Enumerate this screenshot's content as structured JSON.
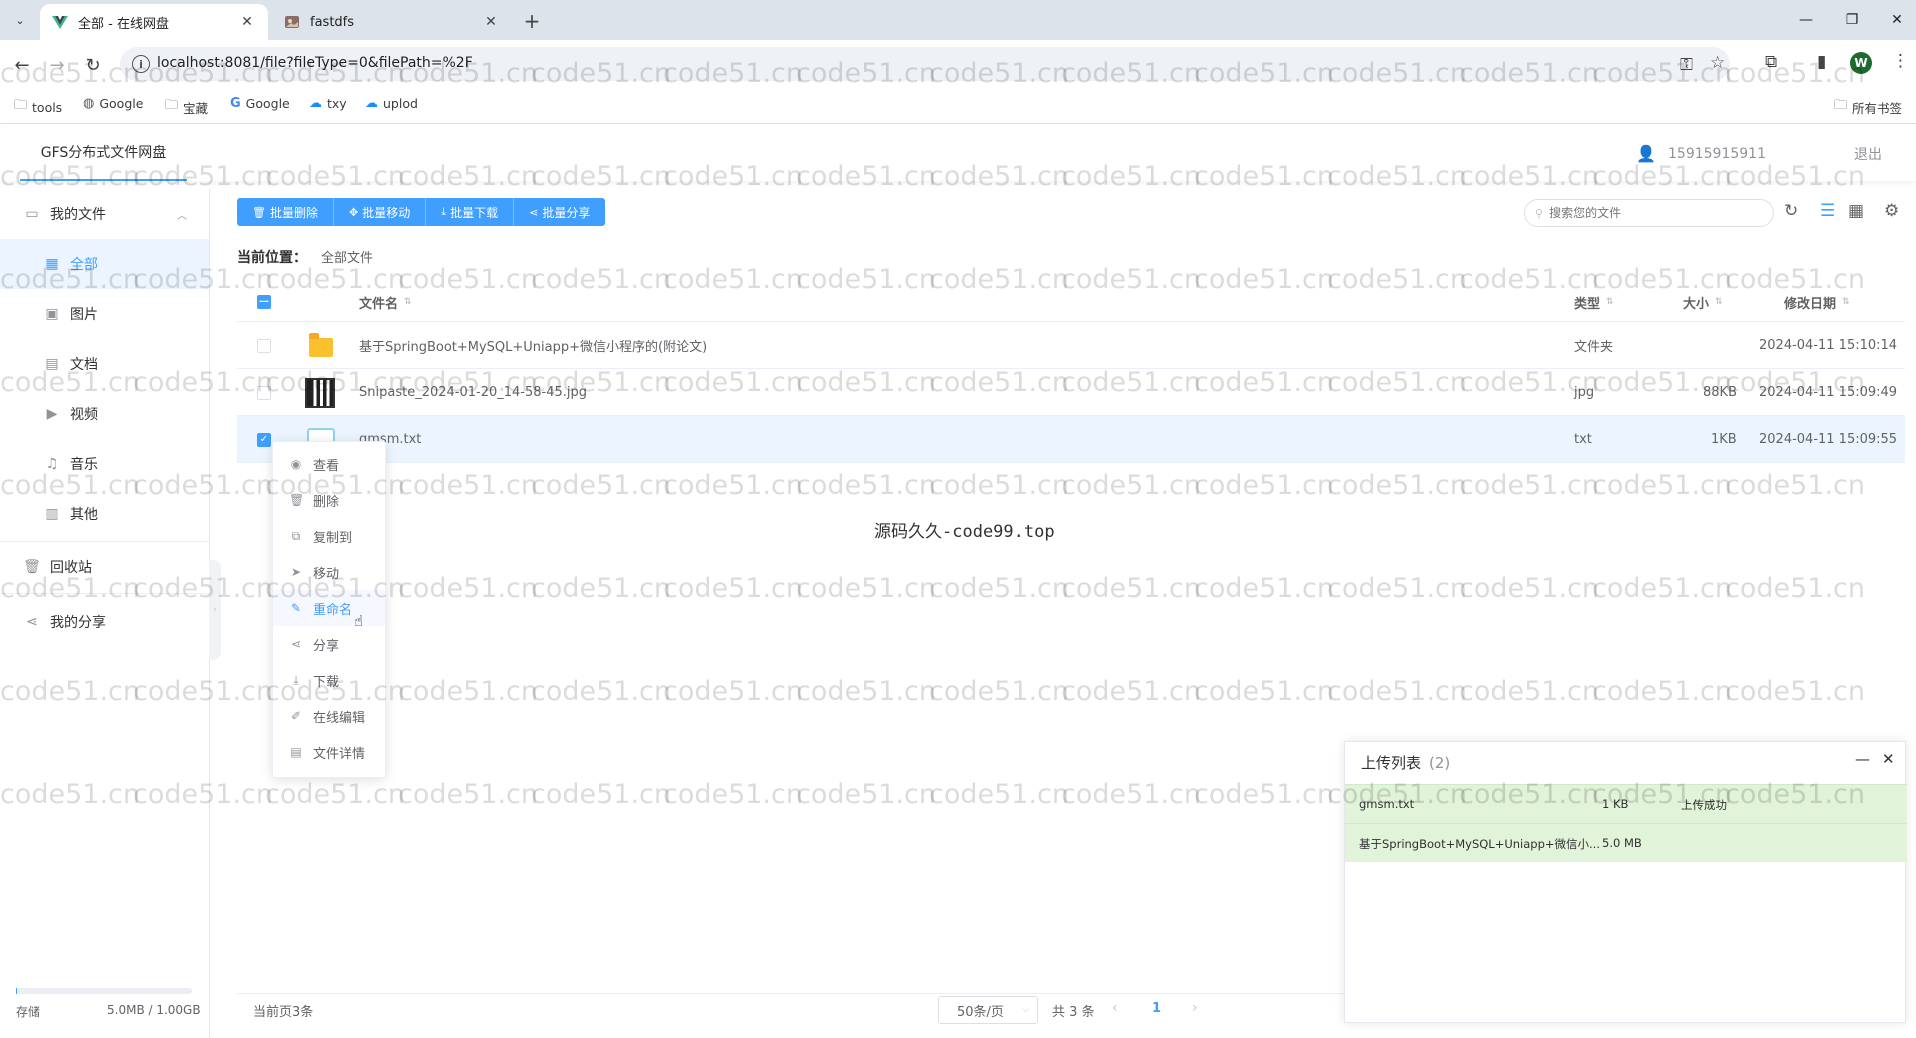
{
  "browser": {
    "tabs": [
      {
        "title": "全部 - 在线网盘",
        "active": true
      },
      {
        "title": "fastdfs",
        "active": false
      }
    ],
    "url": "localhost:8081/file?fileType=0&filePath=%2F",
    "bookmarks": [
      "tools",
      "Google",
      "宝藏",
      "Google",
      "txy",
      "uplod"
    ],
    "all_bookmarks": "所有书签",
    "profile_initial": "W"
  },
  "header": {
    "app_title": "GFS分布式文件网盘",
    "username": "15915915911",
    "logout": "退出"
  },
  "sidebar": {
    "my_files": "我的文件",
    "items": [
      {
        "label": "全部",
        "icon": "grid-icon",
        "active": true
      },
      {
        "label": "图片",
        "icon": "image-icon"
      },
      {
        "label": "文档",
        "icon": "document-icon"
      },
      {
        "label": "视频",
        "icon": "video-icon"
      },
      {
        "label": "音乐",
        "icon": "headphones-icon"
      },
      {
        "label": "其他",
        "icon": "box-icon"
      }
    ],
    "recycle": "回收站",
    "my_share": "我的分享",
    "storage_label": "存储",
    "storage_value": "5.0MB / 1.00GB",
    "storage_fraction": 0.005
  },
  "toolbar": {
    "buttons": [
      "批量删除",
      "批量移动",
      "批量下载",
      "批量分享"
    ],
    "search_placeholder": "搜索您的文件"
  },
  "breadcrumb": {
    "label": "当前位置：",
    "path": "全部文件"
  },
  "table": {
    "headers": {
      "name": "文件名",
      "type": "类型",
      "size": "大小",
      "date": "修改日期"
    },
    "rows": [
      {
        "name": "基于SpringBoot+MySQL+Uniapp+微信小程序的(附论文)",
        "type": "文件夹",
        "size": "",
        "date": "2024-04-11 15:10:14",
        "icon": "folder-icon",
        "checked": false
      },
      {
        "name": "Snipaste_2024-01-20_14-58-45.jpg",
        "type": "jpg",
        "size": "88KB",
        "date": "2024-04-11 15:09:49",
        "icon": "qr-image-icon",
        "checked": false
      },
      {
        "name": "gmsm.txt",
        "type": "txt",
        "size": "1KB",
        "date": "2024-04-11 15:09:55",
        "icon": "txt-file-icon",
        "checked": true
      }
    ]
  },
  "context_menu": [
    {
      "label": "查看",
      "icon": "eye-icon"
    },
    {
      "label": "删除",
      "icon": "trash-icon"
    },
    {
      "label": "复制到",
      "icon": "copy-icon"
    },
    {
      "label": "移动",
      "icon": "send-icon"
    },
    {
      "label": "重命名",
      "icon": "edit-icon",
      "hover": true
    },
    {
      "label": "分享",
      "icon": "share-icon"
    },
    {
      "label": "下载",
      "icon": "download-icon"
    },
    {
      "label": "在线编辑",
      "icon": "pen-icon"
    },
    {
      "label": "文件详情",
      "icon": "detail-icon"
    }
  ],
  "center_text": "源码久久-code99.top",
  "pagination": {
    "page_count": "当前页3条",
    "page_size": "50条/页",
    "total": "共 3 条",
    "current": "1"
  },
  "upload": {
    "title": "上传列表",
    "count": "(2)",
    "items": [
      {
        "name": "gmsm.txt",
        "size": "1 KB",
        "status": "上传成功"
      },
      {
        "name": "基于SpringBoot+MySQL+Uniapp+微信小...",
        "size": "5.0 MB",
        "status": ""
      }
    ]
  },
  "watermark": "code51.cn"
}
